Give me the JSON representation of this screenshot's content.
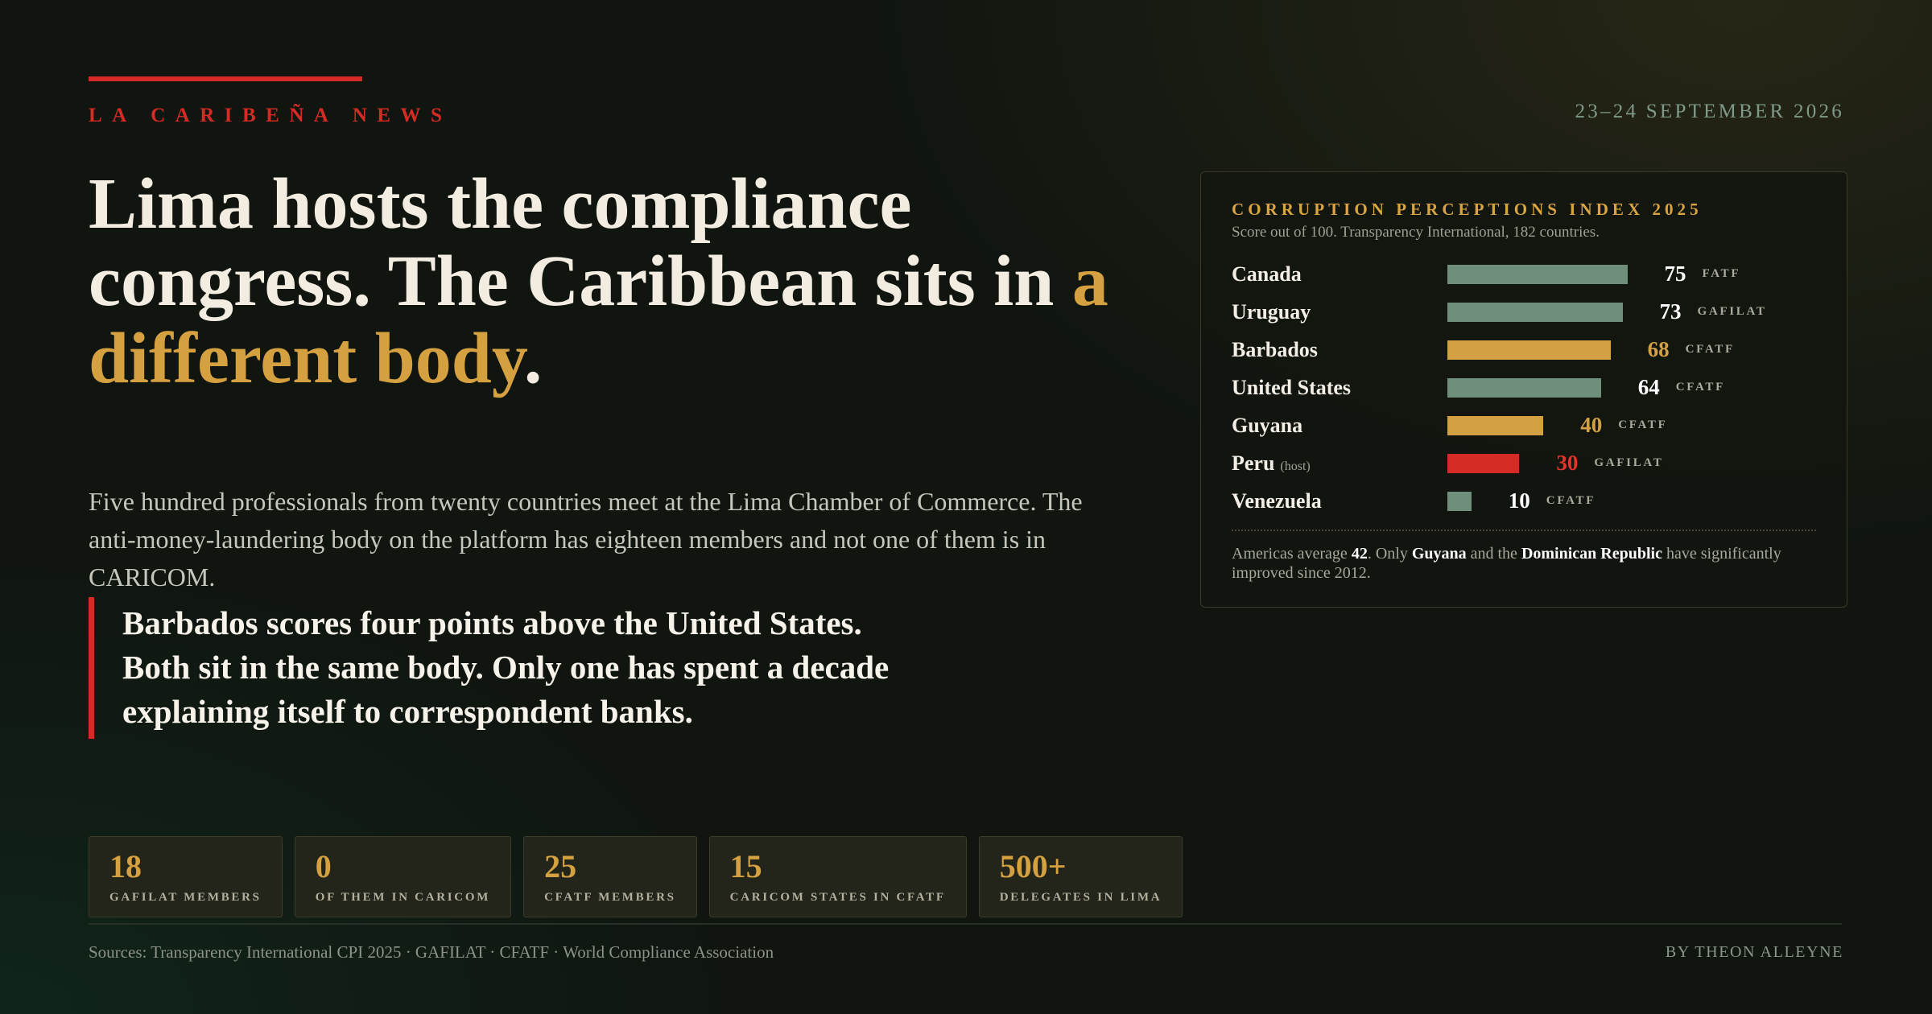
{
  "colors": {
    "accent_red": "#d62b25",
    "gold": "#d4a040",
    "cream": "#f3ede1",
    "sage": "#6f8f7c"
  },
  "brand": {
    "name": "LA CARIBEÑA NEWS"
  },
  "dateline": "23–24 SEPTEMBER 2026",
  "headline": {
    "lead": "Lima hosts the compliance congress. The Caribbean sits in ",
    "highlight": "a different body",
    "tail": "."
  },
  "lede": "Five hundred professionals from twenty countries meet at the Lima Chamber of Commerce. The anti-money-laundering body on the platform has eighteen members and not one of them is in CARICOM.",
  "pull_quote": "Barbados scores four points above the United States. Both sit in the same body. Only one has spent a decade explaining itself to correspondent banks.",
  "chart_data": {
    "type": "bar",
    "orientation": "horizontal",
    "title": "CORRUPTION PERCEPTIONS INDEX 2025",
    "subtitle": "Score out of 100. Transparency International, 182 countries.",
    "xlim": [
      0,
      100
    ],
    "grid": false,
    "categories": [
      "Canada",
      "Uruguay",
      "Barbados",
      "United States",
      "Guyana",
      "Peru",
      "Venezuela"
    ],
    "notes": [
      null,
      null,
      null,
      null,
      null,
      "(host)",
      null
    ],
    "values": [
      75,
      73,
      68,
      64,
      40,
      30,
      10
    ],
    "body": [
      "FATF",
      "GAFILAT",
      "CFATF",
      "CFATF",
      "CFATF",
      "GAFILAT",
      "CFATF"
    ],
    "bar_colors": [
      "#6f8f7c",
      "#6f8f7c",
      "#d4a044",
      "#6f8f7c",
      "#d4a044",
      "#d62b25",
      "#6f8f7c"
    ],
    "value_colors": [
      "#ffffff",
      "#ffffff",
      "#d4a044",
      "#ffffff",
      "#d4a044",
      "#e0352b",
      "#ffffff"
    ],
    "footnote": [
      "Americas average ",
      "42",
      ". Only ",
      "Guyana",
      " and the ",
      "Dominican Republic",
      " have significantly improved since 2012."
    ]
  },
  "stats": [
    {
      "value": "18",
      "label": "GAFILAT MEMBERS"
    },
    {
      "value": "0",
      "label": "OF THEM IN CARICOM"
    },
    {
      "value": "25",
      "label": "CFATF MEMBERS"
    },
    {
      "value": "15",
      "label": "CARICOM STATES IN CFATF"
    },
    {
      "value": "500+",
      "label": "DELEGATES IN LIMA"
    }
  ],
  "footer": {
    "sources": "Sources: Transparency International CPI 2025 · GAFILAT · CFATF · World Compliance Association",
    "byline": "BY THEON ALLEYNE"
  }
}
